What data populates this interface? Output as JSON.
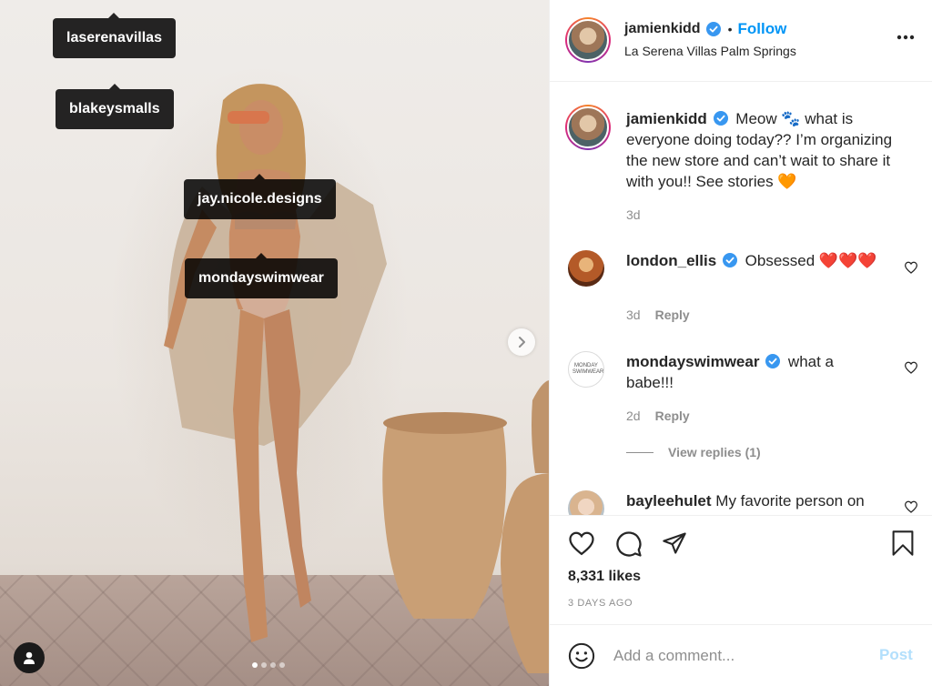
{
  "photo": {
    "tags": [
      "laserenavillas",
      "blakeysmalls",
      "jay.nicole.designs",
      "mondayswimwear"
    ],
    "carousel": {
      "current": 1,
      "total": 4
    },
    "next_icon": "chevron-right-icon",
    "tagged_icon": "person-icon"
  },
  "post": {
    "author": "jamienkidd",
    "verified": true,
    "follow_separator": "•",
    "follow_label": "Follow",
    "location": "La Serena Villas Palm Springs",
    "more_icon": "more-horizontal-icon",
    "caption": {
      "username": "jamienkidd",
      "text": "Meow 🐾 what is everyone doing today?? I’m organizing the new store and can’t wait to share it with you!! See stories 🧡",
      "time": "3d"
    }
  },
  "comments": [
    {
      "username": "london_ellis",
      "verified": true,
      "text": "Obsessed ❤️❤️❤️",
      "time": "3d",
      "reply_label": "Reply"
    },
    {
      "username": "mondayswimwear",
      "verified": true,
      "text": "what a babe!!!",
      "time": "2d",
      "reply_label": "Reply",
      "avatar_text": "MONDAY SWIMWEAR",
      "view_replies": "View replies (1)"
    },
    {
      "username": "bayleehulet",
      "verified": false,
      "text": "My favorite person on"
    }
  ],
  "actions": {
    "icons": [
      "heart-icon",
      "comment-icon",
      "share-icon",
      "bookmark-icon"
    ],
    "likes": "8,331 likes",
    "date": "3 DAYS AGO"
  },
  "composer": {
    "placeholder": "Add a comment...",
    "post_label": "Post",
    "emoji_icon": "smiley-icon"
  },
  "colors": {
    "link_blue": "#0095f6",
    "post_disabled": "#b2dffc",
    "verified_blue": "#3897f0",
    "muted": "#8e8e8e",
    "text": "#262626"
  }
}
